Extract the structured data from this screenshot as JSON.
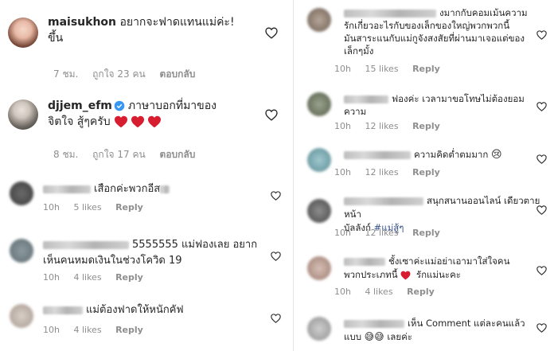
{
  "left": {
    "top_comments": [
      {
        "username": "maisukhon",
        "text_line1": "อยากจะฟาดแทนแม่ค่ะ!",
        "text_line2": "ขึ้น",
        "time": "7 ชม.",
        "likes": "ถูกใจ 23 คน",
        "reply": "ตอบกลับ"
      },
      {
        "username": "djjem_efm",
        "text_line1": "ภาษาบอกที่มาของ",
        "text_line2": "จิตใจ สู้ๆครับ",
        "time": "8 ชม.",
        "likes": "ถูกใจ 17 คน",
        "reply": "ตอบกลับ"
      }
    ],
    "comments": [
      {
        "text_line1": "เสือกค่ะพวกอีส",
        "text_line2": "",
        "time": "10h",
        "likes": "5 likes",
        "reply": "Reply"
      },
      {
        "text_line1": "5555555 แม่ฟองเลย อยาก",
        "text_line2": "เห็นคนหมดเงินในช่วงโควิด 19",
        "time": "10h",
        "likes": "4 likes",
        "reply": "Reply"
      },
      {
        "text_line1": "แม่ต้องฟาดให้หนักคัฟ",
        "text_line2": "",
        "time": "10h",
        "likes": "4 likes",
        "reply": "Reply"
      }
    ]
  },
  "right": {
    "comments": [
      {
        "line1": "งมากกับคอมเม้นความ",
        "line2": "รักเกี่ยวอะไรกับของเล็กของใหญ่พวกพวกนี้",
        "line3": "มันสาระแนกับแม่กูจังสงสัยที่ผ่านมาเจอแต่ของ",
        "line4": "เล็กๆมั้ง",
        "time": "10h",
        "likes": "15 likes",
        "reply": "Reply"
      },
      {
        "line1": "ฟองค่ะ เวลามาขอโทษไม่ต้องยอม",
        "line2": "ความ",
        "time": "10h",
        "likes": "12 likes",
        "reply": "Reply"
      },
      {
        "line1": "ความคิดต่ำตมมาก",
        "time": "10h",
        "likes": "12 likes",
        "reply": "Reply"
      },
      {
        "line1": "สนุกสนานออนไลน์ เดียวตายหน้า",
        "line2": "บัลลังก์",
        "hashtag": "#แม่สู้ๆ",
        "time": "10h",
        "likes": "12 likes",
        "reply": "Reply"
      },
      {
        "line1": "ชั้งเซาค่ะแม่อย่าเอามาใส่ใจคน",
        "line2": "พวกประเภทนี้",
        "line2b": "รักแม่นะคะ",
        "time": "10h",
        "likes": "4 likes",
        "reply": "Reply"
      },
      {
        "line1": "เห็น Comment แต่ละคนแล้ว",
        "line2": "แบบ",
        "line2b": "เลยค่ะ"
      }
    ]
  },
  "colors": {
    "text": "#262626",
    "meta": "#8e8e8e",
    "verified": "#3897f0",
    "heart_red": "#ed2f45",
    "hashtag": "#385185"
  }
}
